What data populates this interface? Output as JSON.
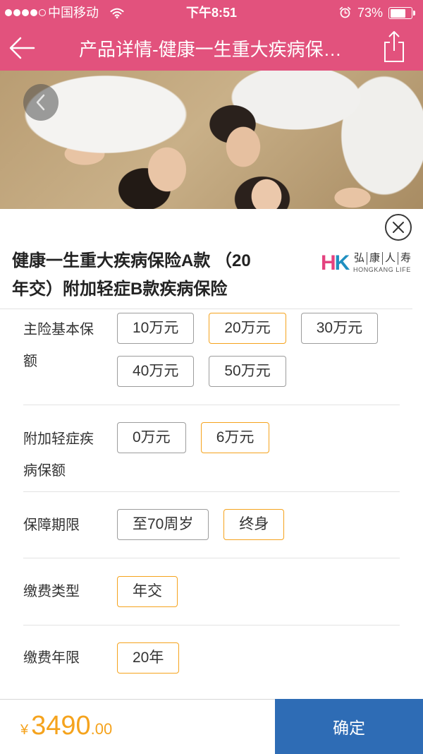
{
  "colors": {
    "header_bg": "#e2527d",
    "accent": "#f5a31d",
    "confirm_bg": "#2e6cb5",
    "logo_h": "#e4427f",
    "logo_k": "#1f8fc0"
  },
  "status_bar": {
    "signal_bars_filled": 4,
    "signal_bars_total": 5,
    "carrier": "中国移动",
    "wifi_icon": "wifi-icon",
    "time": "下午8:51",
    "alarm_icon": "alarm-icon",
    "battery": "73%",
    "battery_icon": "battery-icon"
  },
  "nav": {
    "back_icon": "arrow-left-icon",
    "title": "产品详情-健康一生重大疾病保…",
    "share_icon": "share-icon"
  },
  "banner": {
    "prev_icon": "chevron-left-icon"
  },
  "sheet": {
    "close_icon": "close-icon",
    "title_lines": [
      "健康一生重大疾病保险A款 （20",
      "年交）附加轻症B款疾病保险"
    ],
    "insurer_logo": {
      "mark_h": "H",
      "mark_k": "K",
      "name_chars": [
        "弘",
        "康",
        "人",
        "寿"
      ],
      "en_name": "HONGKANG LIFE"
    },
    "option_groups": [
      {
        "label": "主险基本保额",
        "choices": [
          {
            "text": "10万元",
            "selected": false
          },
          {
            "text": "20万元",
            "selected": true
          },
          {
            "text": "30万元",
            "selected": false
          },
          {
            "text": "40万元",
            "selected": false
          },
          {
            "text": "50万元",
            "selected": false
          }
        ]
      },
      {
        "label": "附加轻症疾病保额",
        "choices": [
          {
            "text": "0万元",
            "selected": false
          },
          {
            "text": "6万元",
            "selected": true
          }
        ]
      },
      {
        "label": "保障期限",
        "choices": [
          {
            "text": "至70周岁",
            "selected": false
          },
          {
            "text": "终身",
            "selected": true
          }
        ]
      },
      {
        "label": "缴费类型",
        "choices": [
          {
            "text": "年交",
            "selected": true
          }
        ]
      },
      {
        "label": "缴费年限",
        "choices": [
          {
            "text": "20年",
            "selected": true
          }
        ]
      }
    ]
  },
  "footer": {
    "currency": "¥",
    "price_integer": "3490",
    "price_decimal": ".00",
    "confirm_label": "确定"
  }
}
